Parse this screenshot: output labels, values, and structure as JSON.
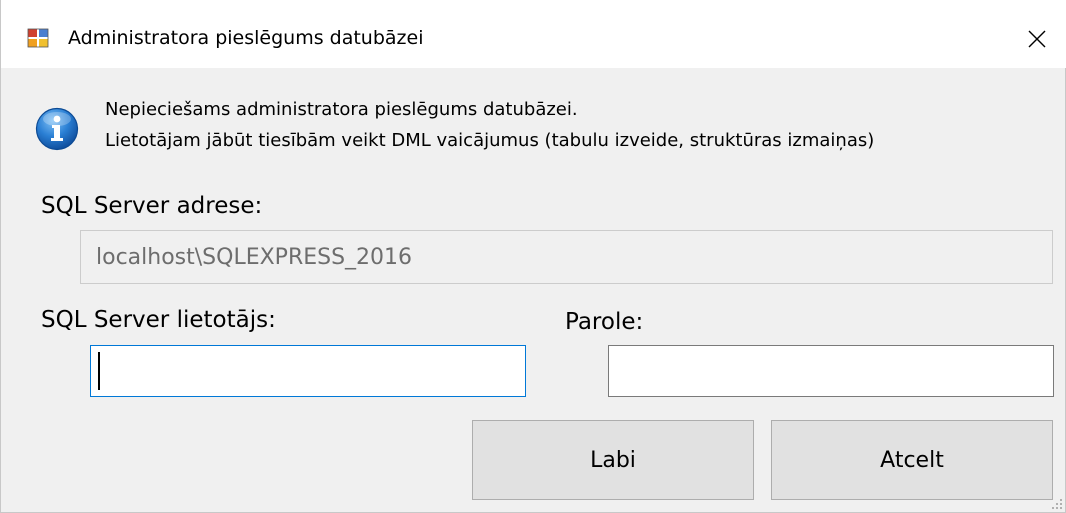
{
  "window": {
    "title": "Administratora pieslēgums datubāzei",
    "close_symbol": "✕",
    "icon": "app-window-icon"
  },
  "info": {
    "icon": "info-icon",
    "line1": "Nepieciešams administratora pieslēgums datubāzei.",
    "line2": "Lietotājam jābūt tiesībām veikt DML vaicājumus (tabulu izveide, struktūras izmaiņas)"
  },
  "form": {
    "server_label": "SQL Server adrese:",
    "server_value": "localhost\\SQLEXPRESS_2016",
    "user_label": "SQL Server lietotājs:",
    "user_value": "",
    "password_label": "Parole:",
    "password_value": ""
  },
  "buttons": {
    "ok_label": "Labi",
    "cancel_label": "Atcelt"
  },
  "colors": {
    "accent": "#0078d7",
    "window_bg": "#f0f0f0",
    "button_bg": "#e1e1e1",
    "info_blue": "#1c6fc4"
  }
}
